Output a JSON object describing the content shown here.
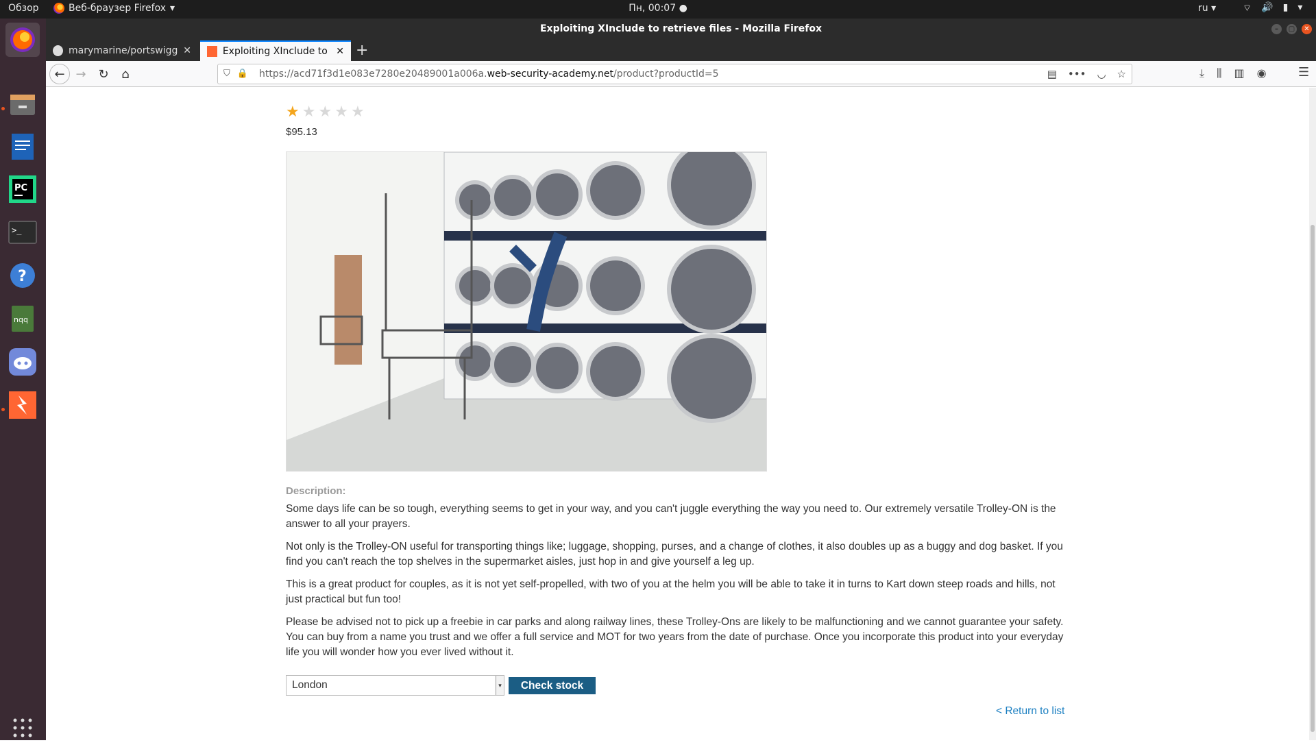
{
  "system": {
    "activities": "Обзор",
    "app_menu": "Веб-браузер Firefox",
    "clock": "Пн, 00:07",
    "lang": "ru"
  },
  "dock": {
    "items": [
      "firefox-icon",
      "files-icon",
      "libreoffice-writer-icon",
      "pycharm-icon",
      "terminal-icon",
      "help-icon",
      "notes-icon",
      "discord-icon",
      "burp-suite-icon"
    ],
    "nqq_label": "nqq",
    "pc_label": "PC"
  },
  "window": {
    "title": "Exploiting XInclude to retrieve files - Mozilla Firefox"
  },
  "tabs": [
    {
      "label": "marymarine/portswigge",
      "active": false
    },
    {
      "label": "Exploiting XInclude to re",
      "active": true
    }
  ],
  "urlbar": {
    "prefix": "https://acd71f3d1e083e7280e20489001a006a.",
    "domain": "web-security-academy.net",
    "path": "/product?productId=5"
  },
  "product": {
    "rating": 1,
    "rating_max": 5,
    "price": "$95.13",
    "description_label": "Description:",
    "description": [
      "Some days life can be so tough, everything seems to get in your way, and you can't juggle everything the way you need to. Our extremely versatile Trolley-ON is the answer to all your prayers.",
      "Not only is the Trolley-ON useful for transporting things like; luggage, shopping, purses, and a change of clothes, it also doubles up as a buggy and dog basket. If you find you can't reach the top shelves in the supermarket aisles, just hop in and give yourself a leg up.",
      "This is a great product for couples, as it is not yet self-propelled, with two of you at the helm you will be able to take it in turns to Kart down steep roads and hills, not just practical but fun too!",
      "Please be advised not to pick up a freebie in car parks and along railway lines, these Trolley-Ons are likely to be malfunctioning and we cannot guarantee your safety. You can buy from a name you trust and we offer a full service and MOT for two years from the date of purchase. Once you incorporate this product into your everyday life you will wonder how you ever lived without it."
    ],
    "stock_location": "London",
    "check_stock_label": "Check stock",
    "return_label": "< Return to list"
  },
  "colors": {
    "star_filled": "#f4a51c",
    "button_bg": "#1b5d84",
    "link": "#1b7fc1",
    "accent": "#e95420"
  }
}
